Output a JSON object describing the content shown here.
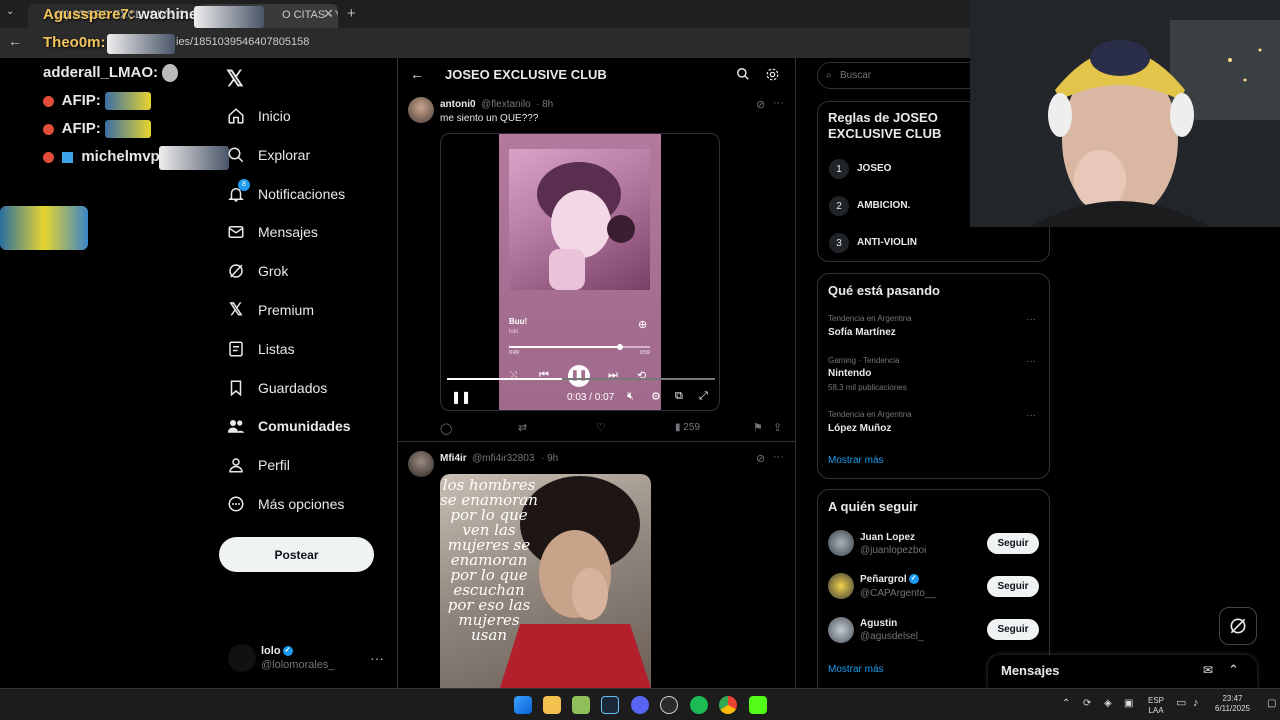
{
  "browser": {
    "tab_title": "(1) JOSEO EXCLUSIVE CLUB / X",
    "tab2_title": "O CITAS - YouT",
    "url": "ies/1851039546407805158"
  },
  "chat": [
    {
      "user": "Agusspere7:",
      "text": "wachines"
    },
    {
      "user": "Theo0m:",
      "text": ""
    },
    {
      "user": "adderall_LMAO:",
      "text": ""
    },
    {
      "user": "AFIP:",
      "text": ""
    },
    {
      "user": "AFIP:",
      "text": ""
    },
    {
      "user": "michelmvp:",
      "text": ""
    }
  ],
  "nav": {
    "items": [
      {
        "label": "Inicio",
        "icon": "home-icon"
      },
      {
        "label": "Explorar",
        "icon": "search-icon"
      },
      {
        "label": "Notificaciones",
        "icon": "bell-icon"
      },
      {
        "label": "Mensajes",
        "icon": "mail-icon"
      },
      {
        "label": "Grok",
        "icon": "grok-icon"
      },
      {
        "label": "Premium",
        "icon": "x-icon"
      },
      {
        "label": "Listas",
        "icon": "list-icon"
      },
      {
        "label": "Guardados",
        "icon": "bookmark-icon"
      },
      {
        "label": "Comunidades",
        "icon": "people-icon"
      },
      {
        "label": "Perfil",
        "icon": "person-icon"
      },
      {
        "label": "Más opciones",
        "icon": "more-circle-icon"
      }
    ],
    "notification_badge": "8",
    "post_label": "Postear",
    "me": {
      "name": "lolo",
      "handle": "@lolomorales_"
    }
  },
  "column": {
    "title": "JOSEO EXCLUSIVE CLUB"
  },
  "tweets": [
    {
      "name": "antoni0",
      "handle": "@flextanilo",
      "time": "· 8h",
      "text": "me siento un QUE???",
      "views": "259",
      "media": {
        "song_title": "Buu!",
        "song_artist": "lolo",
        "elapsed": "0:49",
        "total": "0:59",
        "player_time": "0:03 / 0:07"
      }
    },
    {
      "name": "Mfi4ir",
      "handle": "@mfi4ir32803",
      "time": "· 9h",
      "image_text": "los hombres se enamoran por lo que ven las mujeres se enamoran por lo que escuchan por eso las mujeres usan"
    }
  ],
  "right": {
    "search_placeholder": "Buscar",
    "rules_title": "Reglas de JOSEO EXCLUSIVE CLUB",
    "rules": [
      {
        "num": "1",
        "text": "JOSEO"
      },
      {
        "num": "2",
        "text": "AMBICION."
      },
      {
        "num": "3",
        "text": "ANTI-VIOLIN"
      }
    ],
    "trends_title": "Qué está pasando",
    "trends": [
      {
        "meta": "Tendencia en Argentina",
        "name": "Sofía Martínez",
        "count": ""
      },
      {
        "meta": "Gaming · Tendencia",
        "name": "Nintendo",
        "count": "58,3 mil publicaciones"
      },
      {
        "meta": "Tendencia en Argentina",
        "name": "López Muñoz",
        "count": ""
      }
    ],
    "show_more": "Mostrar más",
    "follow_title": "A quién seguir",
    "follow": [
      {
        "name": "Juan Lopez",
        "handle": "@juanlopezboi",
        "verified": false
      },
      {
        "name": "Peñargrol",
        "handle": "@CAPArgento__",
        "verified": true
      },
      {
        "name": "Agustin",
        "handle": "@agusdelsel_",
        "verified": false
      }
    ],
    "follow_label": "Seguir"
  },
  "messages_dock": {
    "title": "Mensajes"
  },
  "taskbar": {
    "lang": "ESP",
    "lang2": "LAA",
    "time": "23:47",
    "date": "6/11/2025"
  },
  "colors": {
    "accent": "#1d9bf0",
    "background": "#000000",
    "border": "#2f3336",
    "muted": "#71767b"
  }
}
